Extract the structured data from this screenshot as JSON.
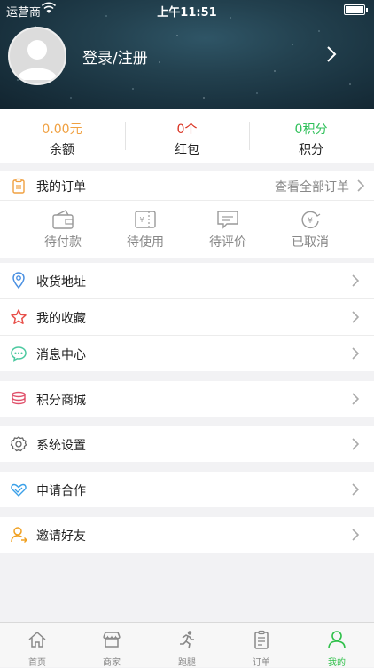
{
  "status_bar": {
    "carrier": "运营商",
    "time": "上午11:51"
  },
  "profile": {
    "login_label": "登录/注册"
  },
  "stats": [
    {
      "value": "0.00元",
      "label": "余额",
      "color": "#f0a040"
    },
    {
      "value": "0个",
      "label": "红包",
      "color": "#d9301f"
    },
    {
      "value": "0积分",
      "label": "积分",
      "color": "#2fc05a"
    }
  ],
  "orders": {
    "title": "我的订单",
    "view_all": "查看全部订单",
    "items": [
      {
        "label": "待付款",
        "icon": "wallet-icon"
      },
      {
        "label": "待使用",
        "icon": "voucher-icon"
      },
      {
        "label": "待评价",
        "icon": "comment-icon"
      },
      {
        "label": "已取消",
        "icon": "cancelled-yen-icon"
      }
    ]
  },
  "menu": [
    {
      "label": "收货地址",
      "icon": "location-pin-icon",
      "color": "#4a90e2"
    },
    {
      "label": "我的收藏",
      "icon": "star-icon",
      "color": "#e8504a"
    },
    {
      "label": "消息中心",
      "icon": "chat-bubble-icon",
      "color": "#4cc9a0"
    },
    {
      "label": "积分商城",
      "icon": "coins-icon",
      "color": "#e0506a"
    },
    {
      "label": "系统设置",
      "icon": "gear-icon",
      "color": "#666666"
    },
    {
      "label": "申请合作",
      "icon": "handshake-icon",
      "color": "#3aa0e8"
    },
    {
      "label": "邀请好友",
      "icon": "invite-user-icon",
      "color": "#f0a020"
    }
  ],
  "tabs": [
    {
      "label": "首页",
      "icon": "home-icon"
    },
    {
      "label": "商家",
      "icon": "store-icon"
    },
    {
      "label": "跑腿",
      "icon": "runner-icon"
    },
    {
      "label": "订单",
      "icon": "clipboard-icon"
    },
    {
      "label": "我的",
      "icon": "user-icon",
      "active": true
    }
  ],
  "colors": {
    "accent": "#2fc04a",
    "header_bg": "#1f3a47"
  }
}
